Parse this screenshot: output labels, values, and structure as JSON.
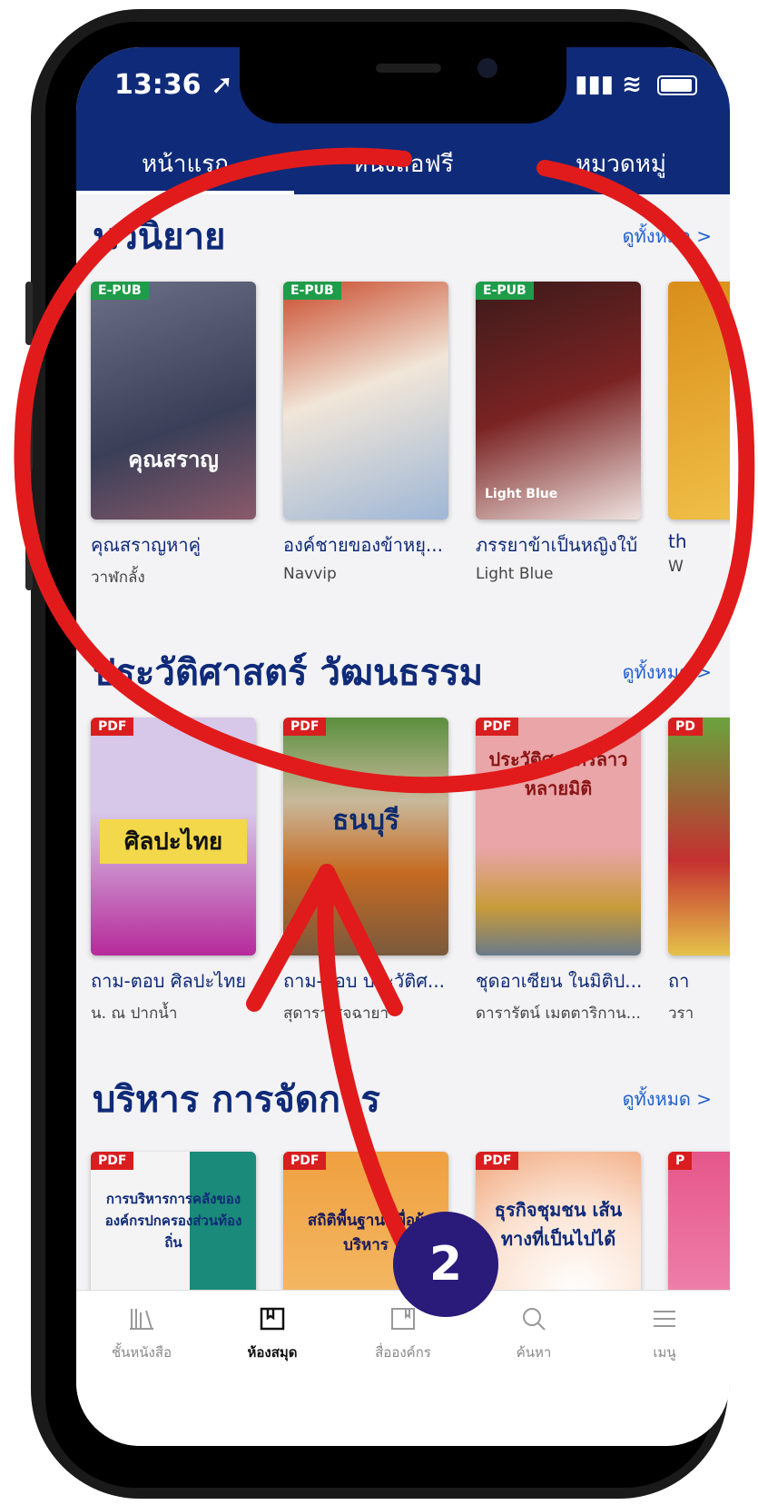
{
  "status": {
    "time": "13:36",
    "signal": "▐▐▐",
    "wifi": "☷"
  },
  "tabs": [
    "หน้าแรก",
    "หนังสือฟรี",
    "หมวดหมู่"
  ],
  "sections": [
    {
      "title": "นวนิยาย",
      "see_all": "ดูทั้งหมด >",
      "books": [
        {
          "badge": "E-PUB",
          "cover_text": "คุณสราญ",
          "title": "คุณสราญหาคู่",
          "author": "วาฬกลั้ง"
        },
        {
          "badge": "E-PUB",
          "cover_text": "",
          "title": "องค์ชายของข้าหยุ...",
          "author": "Navvip"
        },
        {
          "badge": "E-PUB",
          "cover_text": "Light Blue",
          "title": "ภรรยาข้าเป็นหญิงใบ้",
          "author": "Light Blue"
        },
        {
          "badge": "",
          "cover_text": "",
          "title": "th",
          "author": "W"
        }
      ]
    },
    {
      "title": "ประวัติศาสตร์ วัฒนธรรม",
      "see_all": "ดูทั้งหมด >",
      "books": [
        {
          "badge": "PDF",
          "cover_text": "ศิลปะไทย",
          "title": "ถาม-ตอบ ศิลปะไทย",
          "author": "น. ณ ปากน้ำ"
        },
        {
          "badge": "PDF",
          "cover_text": "ธนบุรี",
          "title": "ถาม-ตอบ ประวัติศ...",
          "author": "สุดารา สุจฉายา"
        },
        {
          "badge": "PDF",
          "cover_text": "ประวัติศาสตร์ลาว หลายมิติ",
          "title": "ชุดอาเซียน ในมิติป...",
          "author": "ดารารัตน์ เมตตาริกาน..."
        },
        {
          "badge": "PD",
          "cover_text": "",
          "title": "ถา",
          "author": "วรา"
        }
      ]
    },
    {
      "title": "บริหาร การจัดการ",
      "see_all": "ดูทั้งหมด >",
      "books": [
        {
          "badge": "PDF",
          "cover_text": "การบริหารการคลังขององค์กรปกครองส่วนท้องถิ่น",
          "title": "",
          "author": ""
        },
        {
          "badge": "PDF",
          "cover_text": "สถิติพื้นฐาน เพื่อผู้บริหาร",
          "title": "",
          "author": ""
        },
        {
          "badge": "PDF",
          "cover_text": "ธุรกิจชุมชน เส้นทางที่เป็นไปได้",
          "title": "",
          "author": ""
        },
        {
          "badge": "P",
          "cover_text": "",
          "title": "",
          "author": ""
        }
      ]
    }
  ],
  "bottom_nav": [
    {
      "label": "ชั้นหนังสือ",
      "icon": "shelf-icon",
      "active": false
    },
    {
      "label": "ห้องสมุด",
      "icon": "library-icon",
      "active": true
    },
    {
      "label": "สื่อองค์กร",
      "icon": "org-media-icon",
      "active": false
    },
    {
      "label": "ค้นหา",
      "icon": "search-icon",
      "active": false
    },
    {
      "label": "เมนู",
      "icon": "menu-icon",
      "active": false
    }
  ],
  "annotation": {
    "step_number": "2",
    "color": "#e11b1b"
  }
}
